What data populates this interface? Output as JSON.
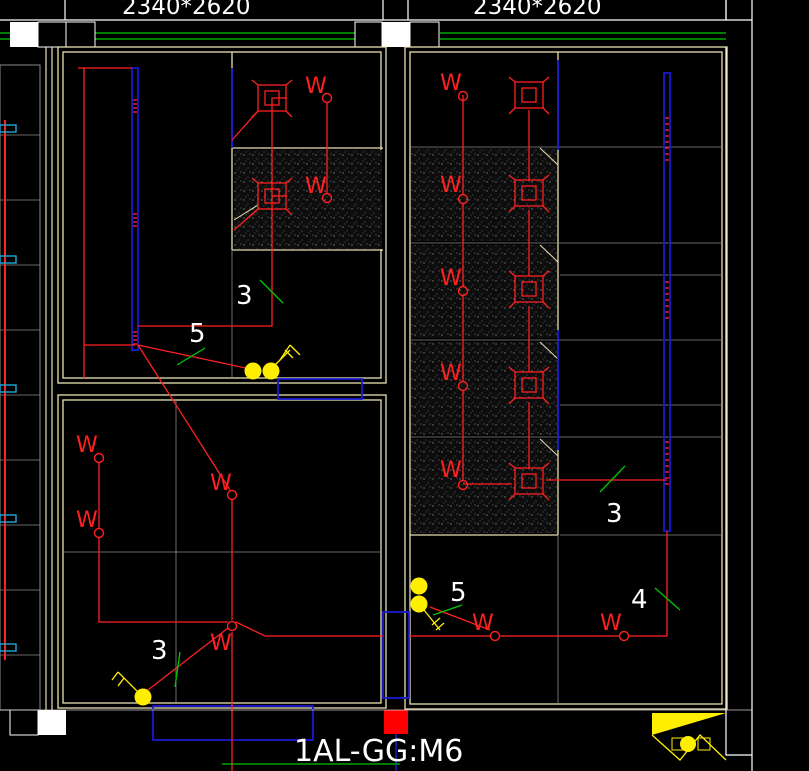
{
  "drawing": {
    "dims_left": "2340*2620",
    "dims_right": "2340*2620",
    "panel_tag": "1AL-GG:M6",
    "wire_counts": [
      "3",
      "5",
      "3",
      "5",
      "3",
      "4"
    ],
    "outlet_label": "W",
    "colors": {
      "background": "#000000",
      "wall": "#e8e0b0",
      "grid": "#8a8a8a",
      "circuit": "#ff2020",
      "conduit": "#1818d0",
      "fixture": "#ffee00",
      "tick": "#00c800",
      "text": "#ffffff"
    }
  }
}
